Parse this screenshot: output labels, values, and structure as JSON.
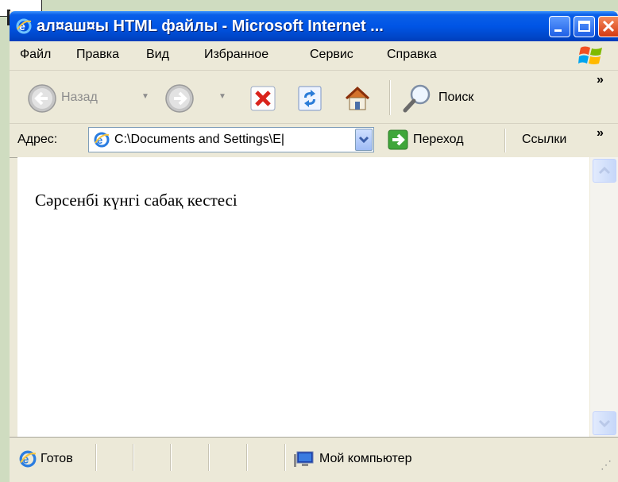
{
  "window": {
    "title": "ал¤аш¤ы HTML файлы - Microsoft Internet ..."
  },
  "menu": [
    "Файл",
    "Правка",
    "Вид",
    "Избранное",
    "Сервис",
    "Справка"
  ],
  "toolbar": {
    "back_label": "Назад",
    "search_label": "Поиск",
    "overflow": "»"
  },
  "address": {
    "label": "Адрес:",
    "value": "C:\\Documents and Settings\\E|",
    "go_label": "Переход",
    "links_label": "Ссылки",
    "overflow": "»"
  },
  "content": {
    "text": "Сәрсенбі күнгі сабақ кестесі"
  },
  "status": {
    "text": "Готов",
    "zone": "Мой компьютер"
  },
  "colors": {
    "titlebar": "#0055e5",
    "chrome": "#ece9d8",
    "page_bg": "#cfdcc0"
  },
  "icons": [
    "ie-icon",
    "minimize-icon",
    "maximize-icon",
    "close-icon",
    "windows-flag-icon",
    "back-arrow-icon",
    "forward-arrow-icon",
    "stop-icon",
    "refresh-icon",
    "home-icon",
    "search-icon",
    "go-arrow-icon",
    "my-computer-icon"
  ]
}
